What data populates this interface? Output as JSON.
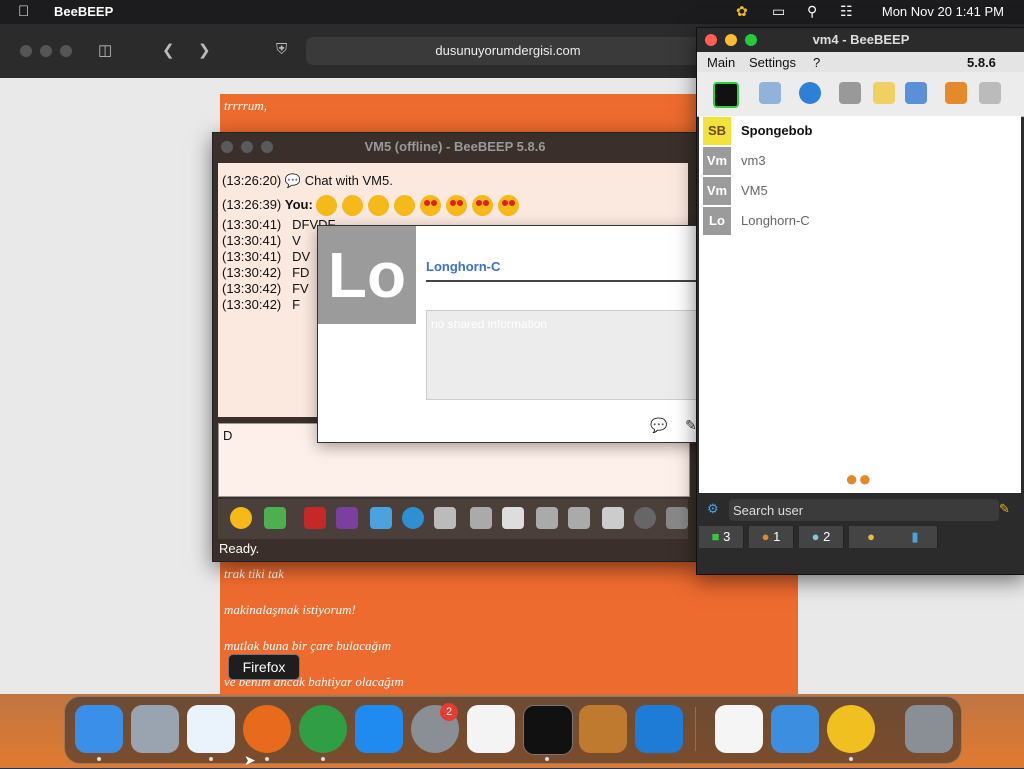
{
  "menubar": {
    "app_name": "BeeBEEP",
    "clock": "Mon Nov 20  1:41 PM",
    "icons": [
      "apple-icon",
      "beebeep-status-icon",
      "screen-mirror-icon",
      "search-icon",
      "control-center-icon"
    ]
  },
  "safari": {
    "url": "dusunuyorumdergisi.com",
    "page_lines": [
      "trrrrum,",
      "trak tiki tak",
      "makinalaşmak istiyorum!",
      "mutlak buna bir çare bulacağım",
      "ve benim ancak bahtiyar olacağım"
    ]
  },
  "vm5": {
    "title": "VM5 (offline) - BeeBEEP 5.8.6",
    "chat": [
      {
        "time": "(13:26:20)",
        "text": "Chat with VM5."
      },
      {
        "time": "(13:26:39)",
        "sender": "You:",
        "emojis": [
          "smirk",
          "smirk",
          "smirk",
          "smirk",
          "heart-eyes",
          "heart-eyes",
          "heart-eyes",
          "heart-eyes"
        ]
      },
      {
        "time": "(13:30:41)",
        "text": "DFVDF"
      },
      {
        "time": "(13:30:41)",
        "text": "V"
      },
      {
        "time": "(13:30:41)",
        "text": "DV"
      },
      {
        "time": "(13:30:42)",
        "text": "FD"
      },
      {
        "time": "(13:30:42)",
        "text": "FV"
      },
      {
        "time": "(13:30:42)",
        "text": "F"
      }
    ],
    "input_text": "D",
    "status": "Ready.",
    "toolbar_icons": [
      "emoticon-icon",
      "send-file-icon",
      "font-icon",
      "color-icon",
      "filter-icon",
      "settings-icon",
      "spellcheck-icon",
      "save-icon",
      "clear-icon",
      "copy-icon",
      "print-icon",
      "html-icon",
      "screenshot-icon",
      "detach-icon"
    ]
  },
  "popup": {
    "avatar_text": "Lo",
    "name": "Longhorn-C",
    "info_placeholder": "no shared information",
    "buttons": [
      "chat-icon",
      "edit-icon",
      "favorite-star-icon",
      "remove-icon"
    ]
  },
  "vm4": {
    "title": "vm4 - BeeBEEP",
    "menu": [
      "Main",
      "Settings",
      "?"
    ],
    "version": "5.8.6",
    "toolbar_icons": [
      "status-icon",
      "profile-icon",
      "broadcast-icon",
      "mailbox-icon",
      "note-icon",
      "network-icon",
      "download-icon",
      "trash-icon"
    ],
    "users": [
      {
        "avatar": "SB",
        "name": "Spongebob",
        "bold": true
      },
      {
        "avatar": "Vm",
        "name": "vm3",
        "bold": false
      },
      {
        "avatar": "Vm",
        "name": "VM5",
        "bold": false
      },
      {
        "avatar": "Lo",
        "name": "Longhorn-C",
        "bold": false
      }
    ],
    "search_placeholder": "Search user",
    "tabs": [
      {
        "icon": "users-icon",
        "count": "3"
      },
      {
        "icon": "groups-icon",
        "count": "1"
      },
      {
        "icon": "chats-icon",
        "count": "2"
      },
      {
        "icon": "network-users-icon",
        "count": ""
      },
      {
        "icon": "files-icon",
        "count": ""
      }
    ]
  },
  "dock": {
    "tooltip": "Firefox",
    "badge": "2",
    "apps": [
      "finder",
      "launchpad",
      "safari",
      "firefox",
      "chrome",
      "app-store",
      "system-settings",
      "textedit",
      "terminal",
      "garageband",
      "vscode",
      "visual-studio",
      "weather",
      "beebeep",
      "trash"
    ]
  }
}
